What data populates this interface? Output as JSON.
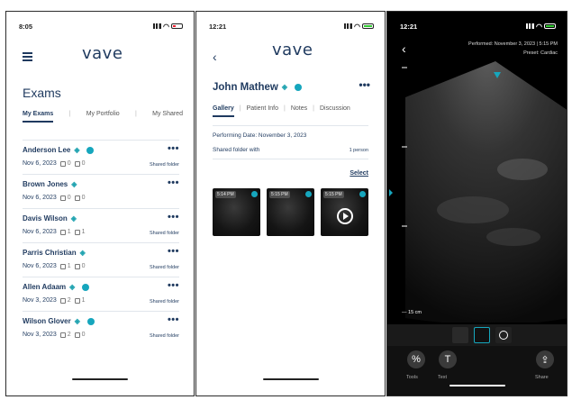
{
  "brand": "vave",
  "colors": {
    "navy": "#1f3a5f",
    "teal": "#16a6bd",
    "probe": "#20a3b0"
  },
  "screen1": {
    "time": "8:05",
    "title": "Exams",
    "tabs": [
      "My Exams",
      "My Portfolio",
      "My Shared"
    ],
    "exams": [
      {
        "name": "Anderson Lee",
        "date": "Nov 6, 2023",
        "images": "0",
        "clips": "0",
        "shared": "Shared folder",
        "teal_badge": true
      },
      {
        "name": "Brown Jones",
        "date": "Nov 6, 2023",
        "images": "0",
        "clips": "0",
        "shared": "",
        "teal_badge": false
      },
      {
        "name": "Davis Wilson",
        "date": "Nov 6, 2023",
        "images": "1",
        "clips": "1",
        "shared": "Shared folder",
        "teal_badge": false
      },
      {
        "name": "Parris Christian",
        "date": "Nov 6, 2023",
        "images": "1",
        "clips": "0",
        "shared": "Shared folder",
        "teal_badge": false
      },
      {
        "name": "Allen Adaam",
        "date": "Nov 3, 2023",
        "images": "2",
        "clips": "1",
        "shared": "Shared folder",
        "teal_badge": true
      },
      {
        "name": "Wilson Glover",
        "date": "Nov 3, 2023",
        "images": "2",
        "clips": "0",
        "shared": "Shared folder",
        "teal_badge": true
      }
    ],
    "more_glyph": "•••"
  },
  "screen2": {
    "time": "12:21",
    "patient": "John Mathew",
    "tabs": [
      "Gallery",
      "Patient Info",
      "Notes",
      "Discussion"
    ],
    "performing_date": "Performing Date: November 3, 2023",
    "shared_folder": "Shared folder with",
    "person_count": "1 person",
    "select": "Select",
    "thumbs": [
      {
        "time": "5:14 PM",
        "video": false
      },
      {
        "time": "5:15 PM",
        "video": false
      },
      {
        "time": "5:15 PM",
        "video": true
      }
    ]
  },
  "screen3": {
    "time": "12:21",
    "performed": "Performed: November 3, 2023 | 5:15 PM",
    "preset": "Preset: Cardiac",
    "depth": "15 cm",
    "tools": [
      {
        "label": "Tools",
        "icon": "percent-icon",
        "glyph": "%"
      },
      {
        "label": "Text",
        "icon": "text-icon",
        "glyph": "T"
      },
      {
        "label": "Share",
        "icon": "share-icon",
        "glyph": "⇪"
      }
    ]
  }
}
